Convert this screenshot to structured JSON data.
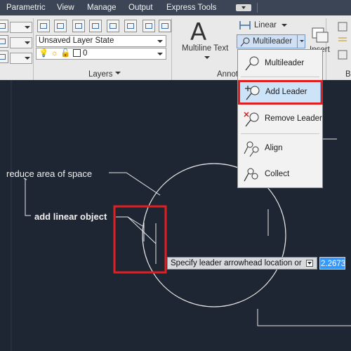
{
  "menubar": {
    "items": [
      "Parametric",
      "View",
      "Manage",
      "Output",
      "Express Tools"
    ]
  },
  "ribbon": {
    "layer_state": "Unsaved Layer State",
    "layer_current": "0",
    "layers_panel_label": "Layers",
    "multiline_text_label": "Multiline Text",
    "big_a_glyph": "A",
    "annotation_label_partial": "Annot",
    "linear_label": "Linear",
    "multileader_label": "Multileader",
    "insert_partial": "Insert",
    "right_partial": "B"
  },
  "dropdown": {
    "items": [
      "Multileader",
      "Add Leader",
      "Remove Leader",
      "Align",
      "Collect"
    ],
    "highlighted": "Add Leader"
  },
  "drawing": {
    "annotation_reduce": "reduce area of space",
    "annotation_add_linear": "add linear object"
  },
  "tooltip": {
    "prompt": "Specify leader arrowhead location or",
    "value": "2.2673"
  },
  "colors": {
    "highlight_box": "#e02020",
    "canvas_bg": "#1f2633",
    "ribbon_bg": "#e9e9e9",
    "selection_blue": "#3399ff"
  }
}
